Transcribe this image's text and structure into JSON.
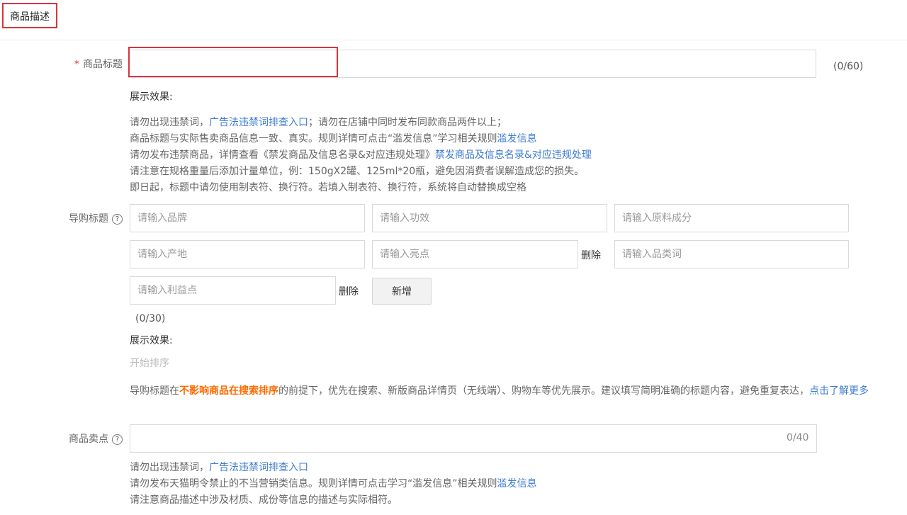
{
  "section": {
    "title": "商品描述"
  },
  "product_title": {
    "required_mark": "*",
    "label": "商品标题",
    "value": "",
    "counter": "(0/60)",
    "preview_label": "展示效果:",
    "tips": {
      "line1_prefix": "请勿出现违禁词，",
      "line1_link": "广告法违禁词排查入口",
      "line1_suffix": "；请勿在店铺中同时发布同款商品两件以上；",
      "line2_prefix": "商品标题与实际售卖商品信息一致、真实。规则详情可点击“滥发信息”学习相关规则",
      "line2_link": "滥发信息",
      "line3_prefix": "请勿发布违禁商品，详情查看《禁发商品及信息名录&对应违规处理》",
      "line3_link": "禁发商品及信息名录&对应违规处理",
      "line4": "请注意在规格重量后添加计量单位，例：150gX2罐、125ml*20瓶，避免因消费者误解造成您的损失。",
      "line5": "即日起，标题中请勿使用制表符、换行符。若填入制表符、换行符，系统将自动替换成空格"
    }
  },
  "guide_title": {
    "label": "导购标题",
    "help_icon": "?",
    "fields": {
      "brand": "请输入品牌",
      "effect": "请输入功效",
      "ingredient": "请输入原料成分",
      "origin": "请输入产地",
      "highlight": "请输入亮点",
      "category": "请输入品类词",
      "benefit": "请输入利益点"
    },
    "delete_label": "删除",
    "add_label": "新增",
    "counter": "(0/30)",
    "preview_label": "展示效果:",
    "sort_label": "开始排序",
    "desc_prefix": "导购标题在",
    "desc_strong": "不影响商品在搜索排序",
    "desc_middle": "的前提下，优先在搜索、新版商品详情页（无线端）、购物车等优先展示。建议填写简明准确的标题内容，避免重复表达，",
    "desc_link": "点击了解更多"
  },
  "selling_point": {
    "label": "商品卖点",
    "help_icon": "?",
    "value": "",
    "counter": "0/40",
    "tips": {
      "line1_prefix": "请勿出现违禁词，",
      "line1_link": "广告法违禁词排查入口",
      "line2_prefix": "请勿发布天猫明令禁止的不当营销类信息。规则详情可点击学习“滥发信息”相关规则",
      "line2_link": "滥发信息",
      "line3": "请注意商品描述中涉及材质、成份等信息的描述与实际相符。"
    }
  },
  "colors": {
    "accent_red": "#d9343b",
    "link_blue": "#3d7bd0",
    "strong_orange": "#ff6a00"
  }
}
